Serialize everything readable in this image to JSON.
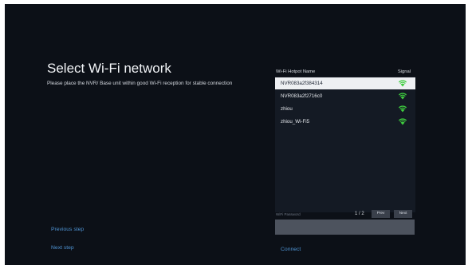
{
  "page": {
    "title": "Select Wi-Fi network",
    "subtitle": "Please place the NVR/ Base unit within good Wi-Fi reception for stable connection"
  },
  "wifi_list": {
    "col_name": "Wi-Fi Hotpot Name",
    "col_signal": "Signal",
    "networks": [
      {
        "ssid": "NVR083a2f384314",
        "selected": true,
        "signal_icon": "wifi-signal-icon"
      },
      {
        "ssid": "NVR083a2f2716c0",
        "selected": false,
        "signal_icon": "wifi-signal-icon"
      },
      {
        "ssid": "zhiou",
        "selected": false,
        "signal_icon": "wifi-signal-icon"
      },
      {
        "ssid": "zhiou_Wi-Fi5",
        "selected": false,
        "signal_icon": "wifi-signal-icon"
      }
    ]
  },
  "password": {
    "label": "WiFi Password",
    "value": "",
    "page_indicator": "1 / 2",
    "prev_label": "Prev",
    "next_label": "Next"
  },
  "actions": {
    "previous_step": "Previous step",
    "next_step": "Next step",
    "connect": "Connect"
  },
  "colors": {
    "background": "#0c1017",
    "list_background": "#141a24",
    "selected_row": "#eef0f3",
    "signal": "#3fce3f",
    "link": "#4e93d3",
    "button": "#3a404b",
    "input": "#4d535e"
  }
}
